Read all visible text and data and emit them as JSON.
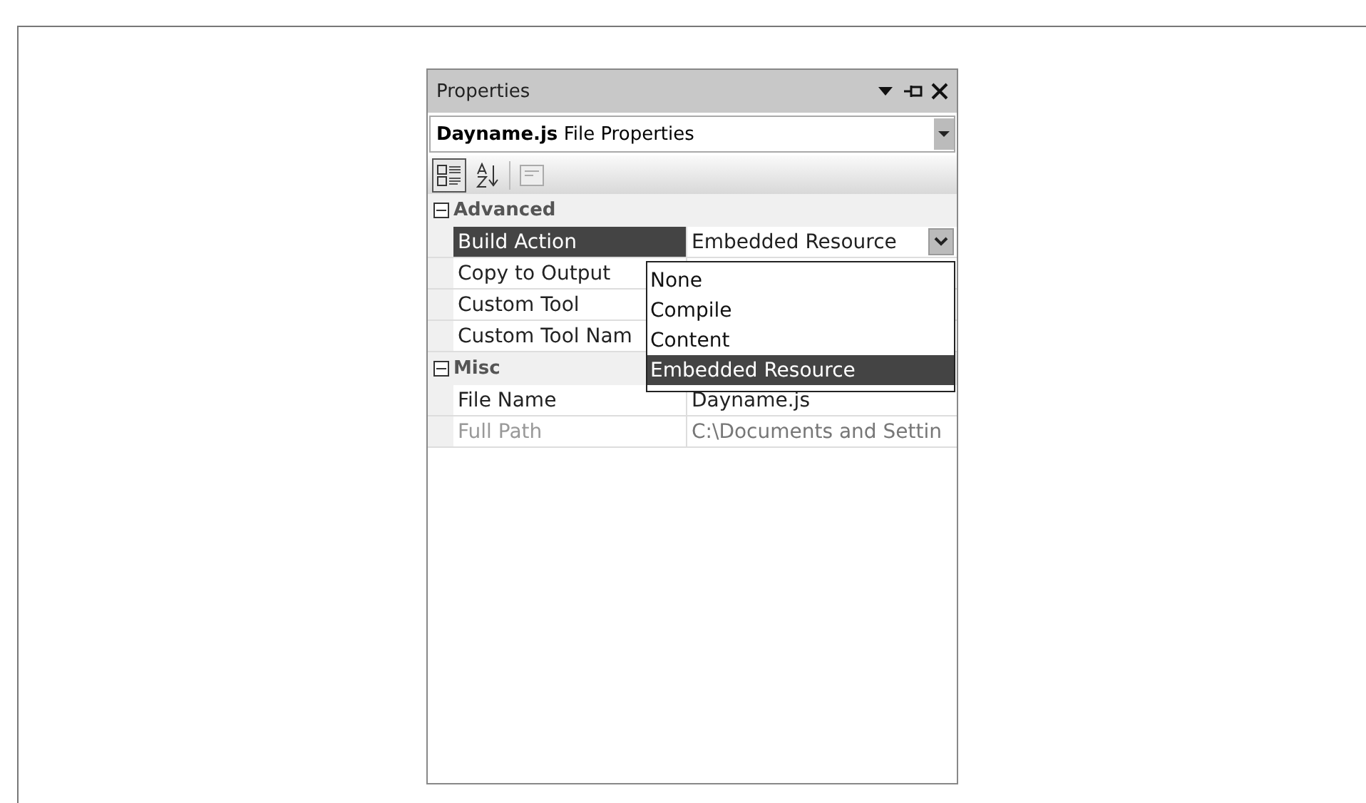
{
  "panel": {
    "title": "Properties",
    "object_selector": {
      "name": "Dayname.js",
      "type": "File Properties"
    },
    "toolbar": [
      {
        "kind": "categorized",
        "selected": true
      },
      {
        "kind": "alphabetical",
        "selected": false
      },
      {
        "kind": "pages",
        "selected": false
      }
    ],
    "categories": [
      {
        "name": "Advanced",
        "expanded": true,
        "properties": [
          {
            "name": "Build Action",
            "value": "Embedded Resource",
            "selected": true,
            "disabled": false,
            "dropdown": true
          },
          {
            "name": "Copy to Output",
            "selected": false,
            "disabled": false
          },
          {
            "name": "Custom Tool",
            "selected": false,
            "disabled": false
          },
          {
            "name": "Custom Tool Nam",
            "selected": false,
            "disabled": false
          }
        ]
      },
      {
        "name": "Misc",
        "expanded": true,
        "properties": [
          {
            "name": "File Name",
            "value": "Dayname.js",
            "selected": false,
            "disabled": false
          },
          {
            "name": "Full Path",
            "value": "C:\\Documents and Settin",
            "selected": false,
            "disabled": true
          }
        ]
      }
    ],
    "dropdown_options": [
      {
        "label": "None",
        "selected": false
      },
      {
        "label": "Compile",
        "selected": false
      },
      {
        "label": "Content",
        "selected": false
      },
      {
        "label": "Embedded Resource",
        "selected": true
      }
    ]
  }
}
